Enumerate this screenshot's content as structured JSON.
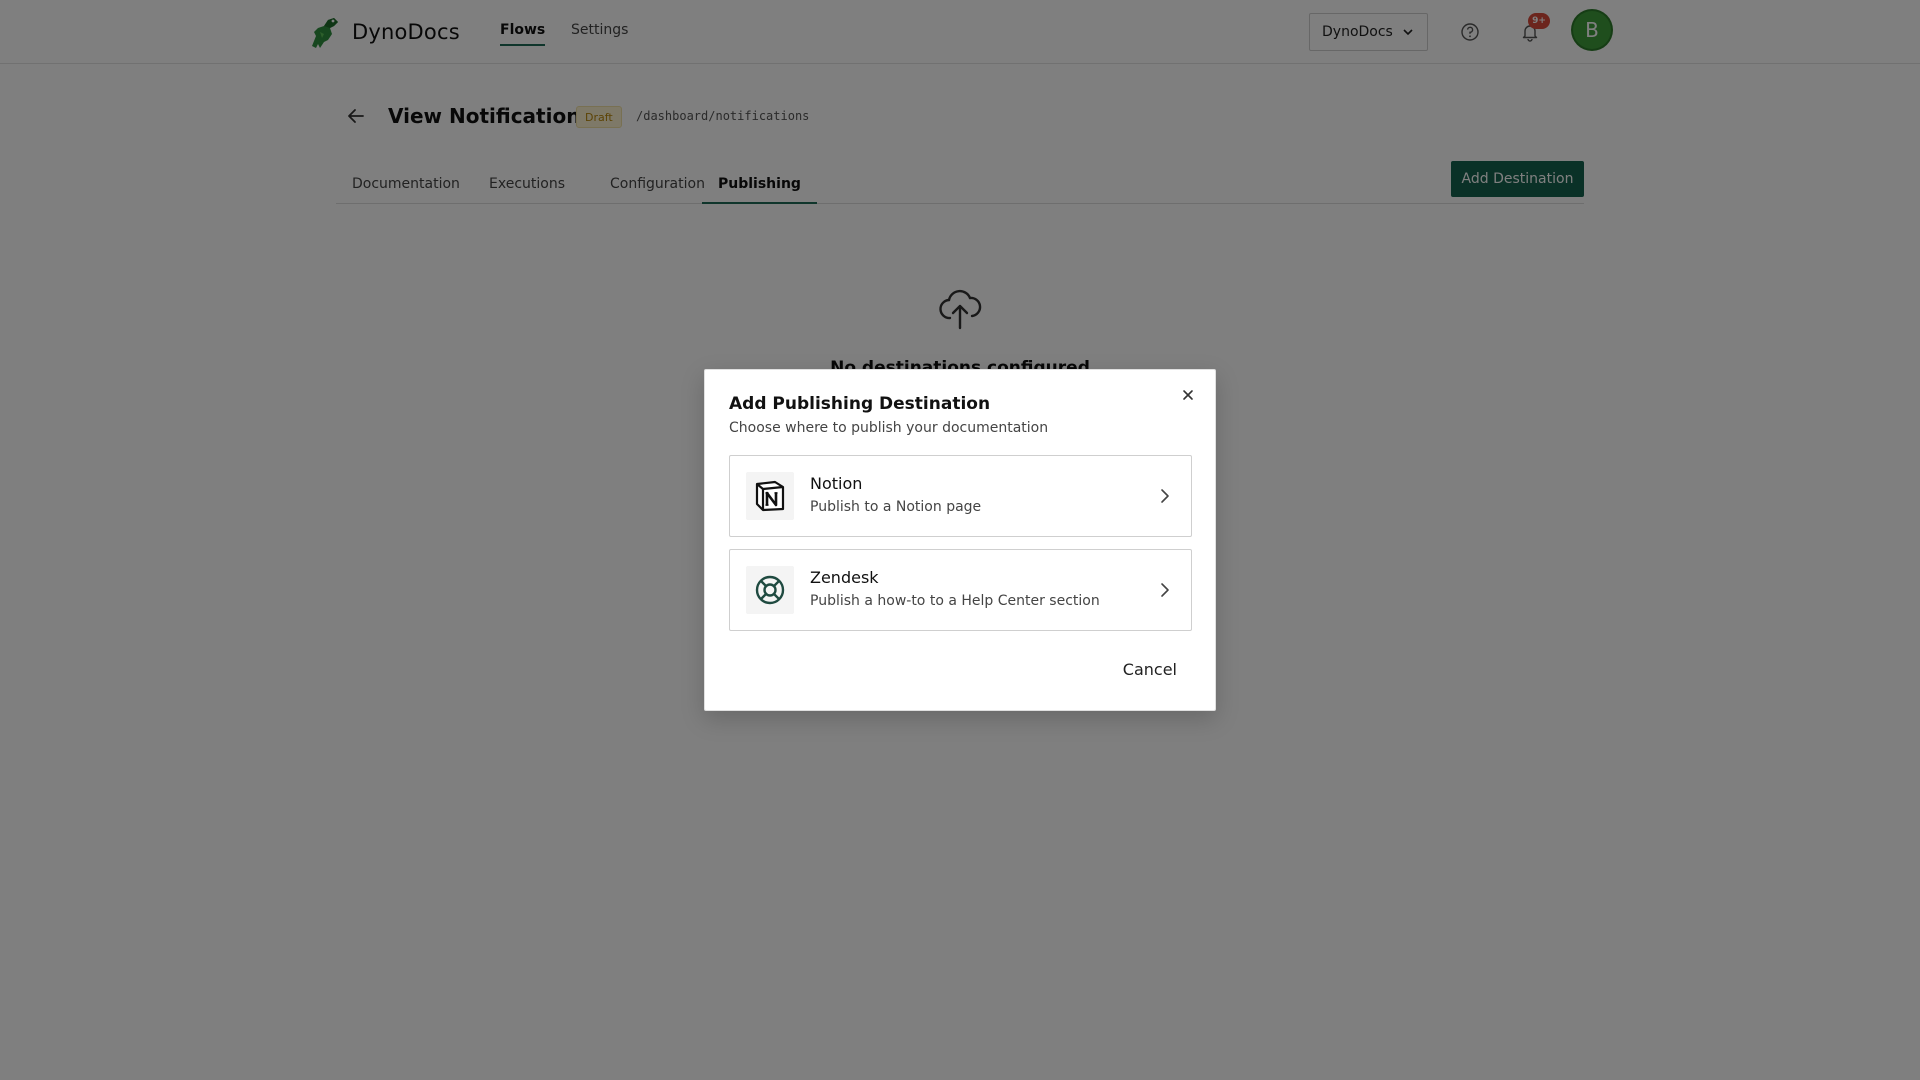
{
  "app": {
    "name": "DynoDocs",
    "nav": [
      {
        "label": "Flows",
        "active": true
      },
      {
        "label": "Settings",
        "active": false
      }
    ],
    "workspace_selector": {
      "value": "DynoDocs"
    },
    "notifications_badge": "9+",
    "avatar_initial": "B"
  },
  "page": {
    "title": "View Notifications",
    "status_badge": "Draft",
    "path": "/dashboard/notifications",
    "tabs": [
      {
        "label": "Documentation",
        "active": false
      },
      {
        "label": "Executions",
        "active": false
      },
      {
        "label": "Configuration",
        "active": false
      },
      {
        "label": "Publishing",
        "active": true
      }
    ],
    "primary_action": "Add Destination",
    "empty_state": {
      "icon": "cloud-upload-icon",
      "text": "No destinations configured"
    }
  },
  "modal": {
    "title": "Add Publishing Destination",
    "subtitle": "Choose where to publish your documentation",
    "options": [
      {
        "name": "Notion",
        "description": "Publish to a Notion page",
        "icon": "notion-icon"
      },
      {
        "name": "Zendesk",
        "description": "Publish a how-to to a Help Center section",
        "icon": "lifebuoy-icon"
      }
    ],
    "cancel_label": "Cancel"
  },
  "colors": {
    "brand_green": "#14634f",
    "badge_red": "#d84a3a",
    "draft_yellow": "#b8860b",
    "avatar_green": "#3e9c3a"
  }
}
